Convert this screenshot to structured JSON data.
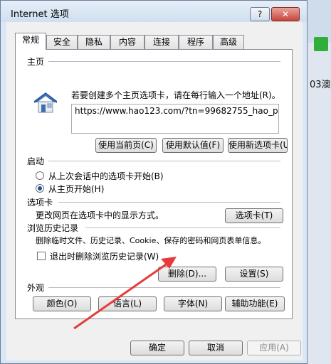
{
  "window": {
    "title": "Internet 选项",
    "help_label": "?",
    "close_label": "✕"
  },
  "tabs": [
    "常规",
    "安全",
    "隐私",
    "内容",
    "连接",
    "程序",
    "高级"
  ],
  "home_page": {
    "title": "主页",
    "instruction": "若要创建多个主页选项卡，请在每行输入一个地址(R)。",
    "url": "https://www.hao123.com/?tn=99682755_hao_p",
    "buttons": {
      "use_current": "使用当前页(C)",
      "use_default": "使用默认值(F)",
      "use_new_tab": "使用新选项卡(U)"
    }
  },
  "startup": {
    "title": "启动",
    "option_last_session": "从上次会话中的选项卡开始(B)",
    "option_home": "从主页开始(H)",
    "selected": "从主页开始(H)"
  },
  "tabs_section": {
    "title": "选项卡",
    "description": "更改网页在选项卡中的显示方式。",
    "button": "选项卡(T)"
  },
  "history": {
    "title": "浏览历史记录",
    "description": "删除临时文件、历史记录、Cookie、保存的密码和网页表单信息。",
    "checkbox": "退出时删除浏览历史记录(W)",
    "delete_button": "删除(D)...",
    "settings_button": "设置(S)"
  },
  "appearance": {
    "title": "外观",
    "buttons": {
      "colors": "颜色(O)",
      "languages": "语言(L)",
      "fonts": "字体(N)",
      "accessibility": "辅助功能(E)"
    }
  },
  "footer": {
    "ok": "确定",
    "cancel": "取消",
    "apply": "应用(A)"
  },
  "background": {
    "text": "03澳"
  },
  "colors": {
    "arrow": "#e83a3a",
    "radio_dot": "#1d4f9e"
  },
  "icons": {
    "home": "house-icon"
  }
}
